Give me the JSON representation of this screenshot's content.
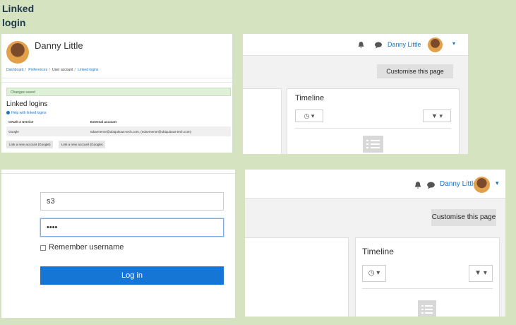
{
  "heading": {
    "line1": "Linked",
    "line2": "login"
  },
  "profile_panel": {
    "user_name": "Danny Little",
    "breadcrumbs": [
      "Dashboard",
      "Preferences",
      "User account",
      "Linked logins"
    ],
    "alert": "Changes saved",
    "page_title": "Linked logins",
    "help_link": "Help with linked logins",
    "table": {
      "headers": [
        "OAuth 2 Service",
        "External account"
      ],
      "rows": [
        [
          "Google",
          "edavmenor@ubiquitous-tech.com, (edavmenor@ubiquitous-tech.com)"
        ]
      ]
    },
    "buttons": [
      "Link a new account (Google)",
      "Link a new account (Google)"
    ]
  },
  "dashboard": {
    "user_name": "Danny Little",
    "customise_label": "Customise this page",
    "timeline_title": "Timeline"
  },
  "login_form": {
    "username_value": "s3",
    "password_value": "••••",
    "remember_label": "Remember username",
    "login_label": "Log in"
  },
  "icons": [
    "bell-icon",
    "chat-icon",
    "clock-icon",
    "filter-icon",
    "list-icon",
    "info-icon"
  ],
  "colors": {
    "accent": "#1a73c8",
    "login_button": "#1576d6",
    "background": "#d5e3c0",
    "alert_bg": "#dff0d8"
  }
}
